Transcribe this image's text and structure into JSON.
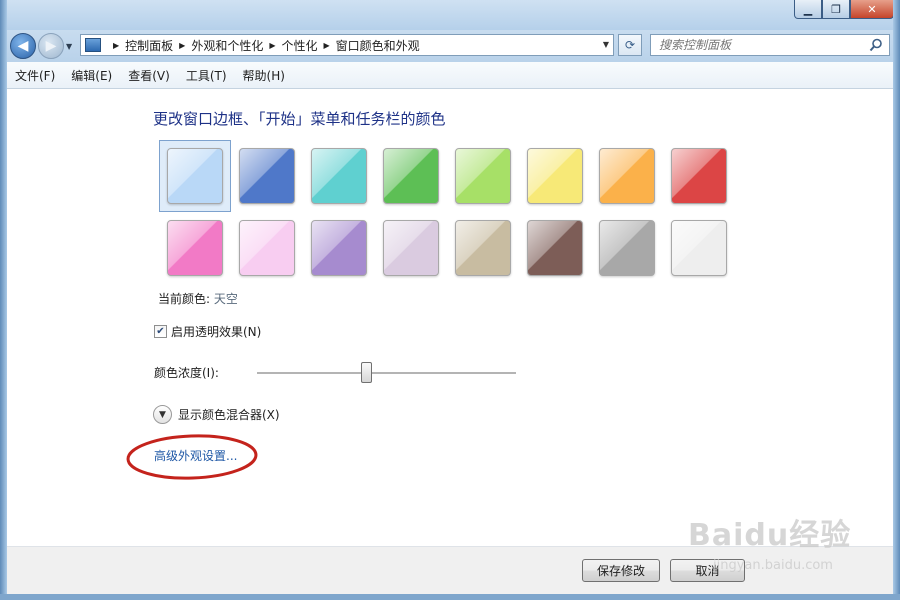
{
  "window": {
    "caption_buttons": {
      "minimize": "▁",
      "maximize": "❐",
      "close": "✕"
    }
  },
  "address_bar": {
    "breadcrumbs": [
      "控制面板",
      "外观和个性化",
      "个性化",
      "窗口颜色和外观"
    ],
    "search_placeholder": "搜索控制面板"
  },
  "menu": [
    "文件(F)",
    "编辑(E)",
    "查看(V)",
    "工具(T)",
    "帮助(H)"
  ],
  "main": {
    "heading": "更改窗口边框、「开始」菜单和任务栏的颜色",
    "colors": [
      {
        "hex": "#b9d8f7",
        "selected": true
      },
      {
        "hex": "#4f78c9",
        "selected": false
      },
      {
        "hex": "#5fd0d0",
        "selected": false
      },
      {
        "hex": "#5dbf55",
        "selected": false
      },
      {
        "hex": "#a7e067",
        "selected": false
      },
      {
        "hex": "#f7e977",
        "selected": false
      },
      {
        "hex": "#fbb14a",
        "selected": false
      },
      {
        "hex": "#dc4545",
        "selected": false
      },
      {
        "hex": "#f27ac6",
        "selected": false
      },
      {
        "hex": "#f8cdf1",
        "selected": false
      },
      {
        "hex": "#a68bcf",
        "selected": false
      },
      {
        "hex": "#dacbe0",
        "selected": false
      },
      {
        "hex": "#c8bca1",
        "selected": false
      },
      {
        "hex": "#7d5d57",
        "selected": false
      },
      {
        "hex": "#a8a8a8",
        "selected": false
      },
      {
        "hex": "#eeeeee",
        "selected": false
      }
    ],
    "current_label": "当前颜色:",
    "current_value": "天空",
    "transparency_label": "启用透明效果(N)",
    "transparency_checked": true,
    "intensity_label": "颜色浓度(I):",
    "intensity_value": 0.42,
    "mixer_label": "显示颜色混合器(X)",
    "advanced_link": "高级外观设置..."
  },
  "footer": {
    "save": "保存修改",
    "cancel": "取消"
  },
  "watermark": {
    "main": "Baidu经验",
    "sub": "jingyan.baidu.com"
  },
  "annotation_color": "#c4231c"
}
